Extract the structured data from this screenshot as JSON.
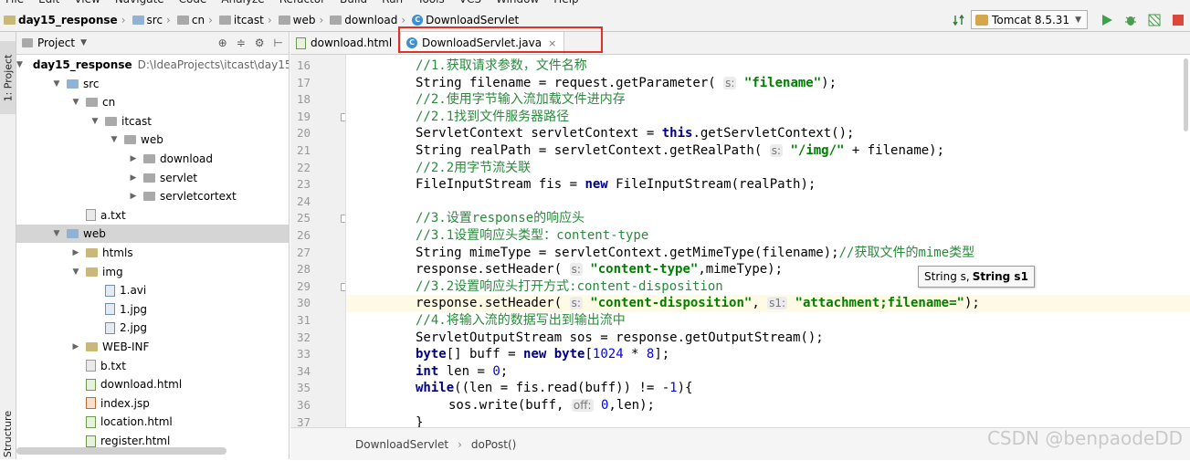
{
  "menu": [
    "File",
    "Edit",
    "View",
    "Navigate",
    "Code",
    "Analyze",
    "Refactor",
    "Build",
    "Run",
    "Tools",
    "VCS",
    "Window",
    "Help"
  ],
  "breadcrumb": [
    {
      "label": "day15_response",
      "icon": "project-folder-icon"
    },
    {
      "label": "src",
      "icon": "folder-icon"
    },
    {
      "label": "cn",
      "icon": "package-icon"
    },
    {
      "label": "itcast",
      "icon": "package-icon"
    },
    {
      "label": "web",
      "icon": "package-icon"
    },
    {
      "label": "download",
      "icon": "package-icon"
    },
    {
      "label": "DownloadServlet",
      "icon": "class-icon"
    }
  ],
  "run_config": {
    "label": "Tomcat 8.5.31"
  },
  "left_strip": {
    "project_tab": "1: Project",
    "structure_tab": "Structure"
  },
  "project_panel": {
    "title": "Project",
    "tree": [
      {
        "label": "day15_response",
        "suffix": "D:\\IdeaProjects\\itcast\\day15",
        "depth": 0,
        "arrow": "down",
        "icon": "folder",
        "bold": true
      },
      {
        "label": "src",
        "depth": 1,
        "arrow": "down",
        "icon": "folder-blue"
      },
      {
        "label": "cn",
        "depth": 2,
        "arrow": "down",
        "icon": "folder-gray"
      },
      {
        "label": "itcast",
        "depth": 3,
        "arrow": "down",
        "icon": "folder-gray"
      },
      {
        "label": "web",
        "depth": 4,
        "arrow": "down",
        "icon": "folder-gray"
      },
      {
        "label": "download",
        "depth": 5,
        "arrow": "right",
        "icon": "folder-gray"
      },
      {
        "label": "servlet",
        "depth": 5,
        "arrow": "right",
        "icon": "folder-gray"
      },
      {
        "label": "servletcortext",
        "depth": 5,
        "arrow": "right",
        "icon": "folder-gray"
      },
      {
        "label": "a.txt",
        "depth": 2,
        "arrow": "",
        "icon": "file"
      },
      {
        "label": "web",
        "depth": 1,
        "arrow": "down",
        "icon": "folder-blue",
        "selected": true
      },
      {
        "label": "htmls",
        "depth": 2,
        "arrow": "right",
        "icon": "folder"
      },
      {
        "label": "img",
        "depth": 2,
        "arrow": "down",
        "icon": "folder"
      },
      {
        "label": "1.avi",
        "depth": 3,
        "arrow": "",
        "icon": "img"
      },
      {
        "label": "1.jpg",
        "depth": 3,
        "arrow": "",
        "icon": "img"
      },
      {
        "label": "2.jpg",
        "depth": 3,
        "arrow": "",
        "icon": "img"
      },
      {
        "label": "WEB-INF",
        "depth": 2,
        "arrow": "right",
        "icon": "folder"
      },
      {
        "label": "b.txt",
        "depth": 2,
        "arrow": "",
        "icon": "file"
      },
      {
        "label": "download.html",
        "depth": 2,
        "arrow": "",
        "icon": "html"
      },
      {
        "label": "index.jsp",
        "depth": 2,
        "arrow": "",
        "icon": "jsp"
      },
      {
        "label": "location.html",
        "depth": 2,
        "arrow": "",
        "icon": "html"
      },
      {
        "label": "register.html",
        "depth": 2,
        "arrow": "",
        "icon": "html"
      }
    ]
  },
  "editor_tabs": [
    {
      "label": "download.html",
      "icon": "html-file-icon",
      "active": false
    },
    {
      "label": "DownloadServlet.java",
      "icon": "class-icon",
      "active": true,
      "close": "×"
    }
  ],
  "code_lines": [
    {
      "n": "16",
      "segs": [
        [
          "ind",
          ""
        ],
        [
          "cmt",
          "//1.获取请求参数，文件名称"
        ]
      ]
    },
    {
      "n": "17",
      "segs": [
        [
          "ind",
          ""
        ],
        [
          "t",
          "String filename = request.getParameter( "
        ],
        [
          "hint",
          "s:"
        ],
        [
          "st",
          " \"filename\""
        ],
        [
          "t",
          ");"
        ]
      ]
    },
    {
      "n": "18",
      "segs": [
        [
          "ind",
          ""
        ],
        [
          "cmt",
          "//2.使用字节输入流加载文件进内存"
        ]
      ]
    },
    {
      "n": "19",
      "segs": [
        [
          "ind",
          ""
        ],
        [
          "cmt",
          "//2.1找到文件服务器路径"
        ]
      ]
    },
    {
      "n": "20",
      "segs": [
        [
          "ind",
          ""
        ],
        [
          "t",
          "ServletContext servletContext = "
        ],
        [
          "kw",
          "this"
        ],
        [
          "t",
          ".getServletContext();"
        ]
      ]
    },
    {
      "n": "21",
      "segs": [
        [
          "ind",
          ""
        ],
        [
          "t",
          "String realPath = servletContext.getRealPath( "
        ],
        [
          "hint",
          "s:"
        ],
        [
          "st",
          " \"/img/\""
        ],
        [
          "t",
          " + filename);"
        ]
      ]
    },
    {
      "n": "22",
      "segs": [
        [
          "ind",
          ""
        ],
        [
          "cmt",
          "//2.2用字节流关联"
        ]
      ]
    },
    {
      "n": "23",
      "segs": [
        [
          "ind",
          ""
        ],
        [
          "t",
          "FileInputStream fis = "
        ],
        [
          "kw",
          "new"
        ],
        [
          "t",
          " FileInputStream(realPath);"
        ]
      ]
    },
    {
      "n": "24",
      "segs": []
    },
    {
      "n": "25",
      "segs": [
        [
          "ind",
          ""
        ],
        [
          "cmt",
          "//3.设置response的响应头"
        ]
      ]
    },
    {
      "n": "26",
      "segs": [
        [
          "ind",
          ""
        ],
        [
          "cmt",
          "//3.1设置响应头类型：content-type"
        ]
      ]
    },
    {
      "n": "27",
      "segs": [
        [
          "ind",
          ""
        ],
        [
          "t",
          "String mimeType = servletContext.getMimeType(filename);"
        ],
        [
          "cmt",
          "//获取文件的mime类型"
        ]
      ]
    },
    {
      "n": "28",
      "segs": [
        [
          "ind",
          ""
        ],
        [
          "t",
          "response.setHeader( "
        ],
        [
          "hint",
          "s:"
        ],
        [
          "st",
          " \"content-type\""
        ],
        [
          "t",
          ",mimeType);"
        ]
      ]
    },
    {
      "n": "29",
      "segs": [
        [
          "ind",
          ""
        ],
        [
          "cmt",
          "//3.2设置响应头打开方式:content-disposition"
        ]
      ]
    },
    {
      "n": "30",
      "cur": true,
      "segs": [
        [
          "ind",
          ""
        ],
        [
          "t",
          "response.setHeader( "
        ],
        [
          "hint",
          "s:"
        ],
        [
          "st",
          " \"content-disposition\""
        ],
        [
          "t",
          ", "
        ],
        [
          "hint",
          "s1:"
        ],
        [
          "st",
          " \"attachment;filename=\""
        ],
        [
          "t",
          ");"
        ]
      ]
    },
    {
      "n": "31",
      "segs": [
        [
          "ind",
          ""
        ],
        [
          "cmt",
          "//4.将输入流的数据写出到输出流中"
        ]
      ]
    },
    {
      "n": "32",
      "segs": [
        [
          "ind",
          ""
        ],
        [
          "t",
          "ServletOutputStream sos = response.getOutputStream();"
        ]
      ]
    },
    {
      "n": "33",
      "segs": [
        [
          "ind",
          ""
        ],
        [
          "kw",
          "byte"
        ],
        [
          "t",
          "[] buff = "
        ],
        [
          "kw",
          "new"
        ],
        [
          "t",
          " "
        ],
        [
          "kw",
          "byte"
        ],
        [
          "t",
          "["
        ],
        [
          "num",
          "1024"
        ],
        [
          "t",
          " * "
        ],
        [
          "num",
          "8"
        ],
        [
          "t",
          "];"
        ]
      ]
    },
    {
      "n": "34",
      "segs": [
        [
          "ind",
          ""
        ],
        [
          "kw",
          "int"
        ],
        [
          "t",
          " len = "
        ],
        [
          "num",
          "0"
        ],
        [
          "t",
          ";"
        ]
      ]
    },
    {
      "n": "35",
      "segs": [
        [
          "ind",
          ""
        ],
        [
          "kw",
          "while"
        ],
        [
          "t",
          "((len = fis.read(buff)) != -"
        ],
        [
          "num",
          "1"
        ],
        [
          "t",
          "){"
        ]
      ]
    },
    {
      "n": "36",
      "segs": [
        [
          "ind2",
          ""
        ],
        [
          "t",
          "sos.write(buff, "
        ],
        [
          "hint",
          "off:"
        ],
        [
          "t",
          " "
        ],
        [
          "num",
          "0"
        ],
        [
          "t",
          ",len);"
        ]
      ]
    },
    {
      "n": "37",
      "segs": [
        [
          "ind",
          ""
        ],
        [
          "t",
          "}"
        ]
      ]
    }
  ],
  "tooltip": {
    "plain": "String s,",
    "bold": "String s1"
  },
  "status_breadcrumb": {
    "class": "DownloadServlet",
    "sep": "›",
    "method": "doPost()"
  },
  "watermark": "CSDN @benpaodeDD"
}
